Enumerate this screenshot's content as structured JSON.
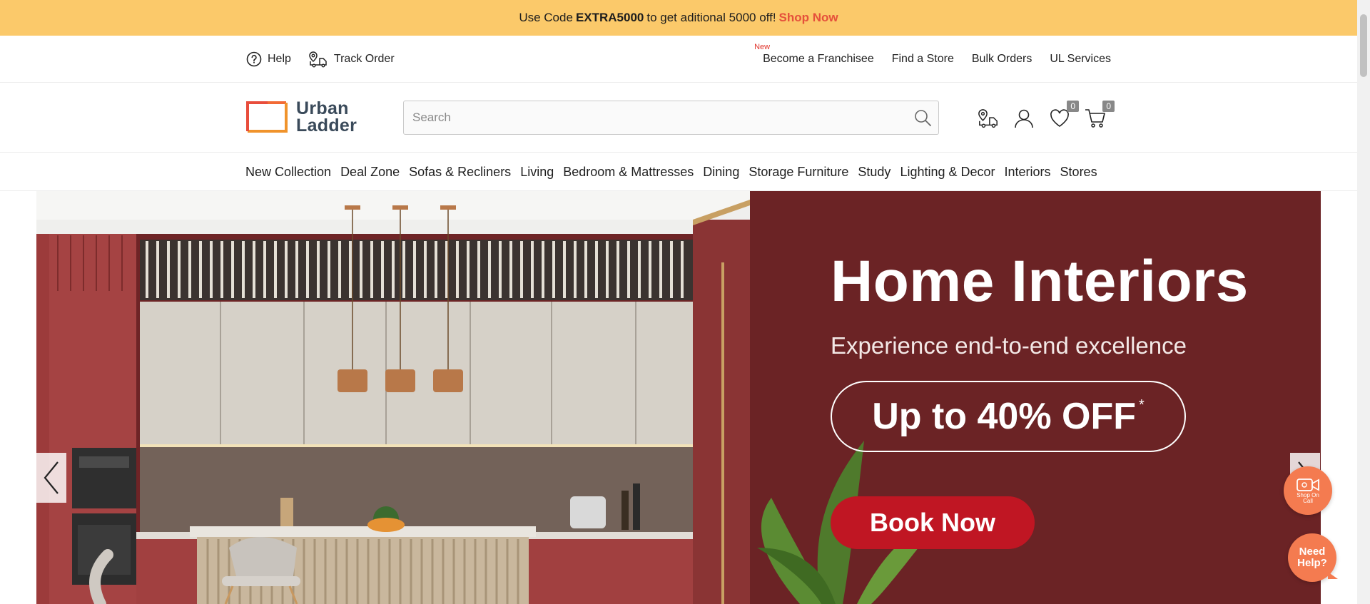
{
  "promo": {
    "prefix": "Use Code",
    "code": "EXTRA5000",
    "suffix": "to get aditional 5000 off!",
    "link": "Shop Now"
  },
  "utility": {
    "help": "Help",
    "track_order": "Track Order",
    "new_badge": "New",
    "links": [
      "Become a Franchisee",
      "Find a Store",
      "Bulk Orders",
      "UL Services"
    ]
  },
  "header": {
    "logo_line1": "Urban",
    "logo_line2": "Ladder",
    "search_placeholder": "Search",
    "wishlist_count": "0",
    "cart_count": "0"
  },
  "nav": {
    "items": [
      "New Collection",
      "Deal Zone",
      "Sofas & Recliners",
      "Living",
      "Bedroom & Mattresses",
      "Dining",
      "Storage Furniture",
      "Study",
      "Lighting & Decor",
      "Interiors",
      "Stores"
    ]
  },
  "hero": {
    "title": "Home Interiors",
    "subtitle": "Experience end-to-end excellence",
    "offer": "Up to 40% OFF",
    "offer_mark": "*",
    "cta": "Book Now"
  },
  "floating": {
    "shop_on_call_line1": "Shop On",
    "shop_on_call_line2": "Call",
    "need_help_line1": "Need",
    "need_help_line2": "Help?"
  },
  "colors": {
    "promo_bg": "#fbc96a",
    "promo_link": "#e5503b",
    "logo_orange": "#f26a35",
    "hero_bg": "#7a2a2a",
    "cta_red": "#c01623",
    "float_orange": "#f47b50"
  },
  "icons": [
    "help-icon",
    "track-order-icon",
    "search-icon",
    "store-locator-icon",
    "user-icon",
    "heart-icon",
    "cart-icon",
    "chevron-left-icon",
    "chevron-right-icon",
    "video-call-icon"
  ]
}
